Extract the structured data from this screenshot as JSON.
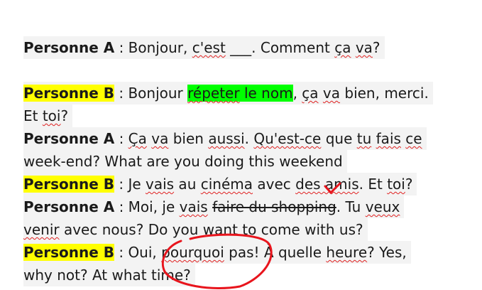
{
  "dialogue": {
    "line1": {
      "speaker": "Personne A",
      "sep": " : ",
      "t1": "Bonjour, ",
      "t2": "c'est",
      "t3": " ___. Comment ",
      "t4": "ça",
      "t5": " ",
      "t6": "va",
      "t7": "?"
    },
    "line2": {
      "speaker": "Personne B",
      "sep": " : ",
      "t1": "Bonjour ",
      "t2": "répeter",
      "t3": " le nom",
      "t4": ", ",
      "t5": "ça",
      "t6": " ",
      "t7": "va",
      "t8": " bien, merci."
    },
    "line3": {
      "t1": "Et ",
      "t2": "toi",
      "t3": "?"
    },
    "line4": {
      "speaker": "Personne A",
      "sep": " : ",
      "t1": "Ça",
      "t2": " ",
      "t3": "va",
      "t4": " bien ",
      "t5": "aussi",
      "t6": ". ",
      "t7": "Qu'est-ce",
      "t8": " que ",
      "t9": "tu",
      "t10": " ",
      "t11": "fais",
      "t12": " ",
      "t13": "ce"
    },
    "line5": {
      "t1": "week-end? What are you doing this weekend"
    },
    "line6": {
      "speaker": "Personne B",
      "sep": " : ",
      "t1": "Je ",
      "t2": "vais",
      "t3": " au ",
      "t4": "cinéma",
      "t5": " avec ",
      "t6": "des amis",
      "t7": ". Et ",
      "t8": "toi",
      "t9": "?"
    },
    "line7": {
      "speaker": "Personne A",
      "sep": " : ",
      "t1": "Moi, je ",
      "t2": "vais",
      "t3": " ",
      "t4": "faire du shopping",
      "t5": ". Tu ",
      "t6": "veux"
    },
    "line8": {
      "t1": "venir",
      "t2": " avec nous? Do you want to come with us?"
    },
    "line9": {
      "speaker": "Personne B",
      "sep": " : ",
      "t1": "Oui, ",
      "t2": "pourquoi",
      "t3": " pas! À quelle ",
      "t4": "heure",
      "t5": "? Yes,"
    },
    "line10": {
      "t1": "why not? At what time?"
    }
  },
  "colors": {
    "highlight_yellow": "#ffff00",
    "highlight_green": "#00ff00",
    "ink_red": "#e8141c",
    "spellcheck": "#e02020"
  },
  "annotations": {
    "ink_checkmark": "handwritten-checkmark",
    "ink_circle": "handwritten-circle"
  }
}
